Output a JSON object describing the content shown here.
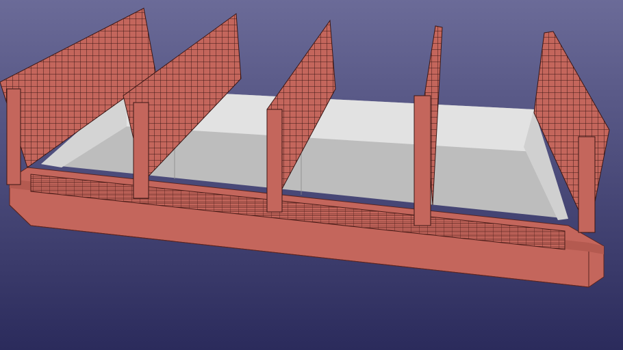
{
  "scene": {
    "subject": "barge-3d-model",
    "colors": {
      "background_top": "#6b6b98",
      "background_bottom": "#2b2b5c",
      "hull": "#c4665c",
      "hull_dark": "#9e4a42",
      "hold_floor": "#bdbdbd",
      "hold_wall": "#dcdcdc",
      "lattice": "#3a1614"
    }
  }
}
